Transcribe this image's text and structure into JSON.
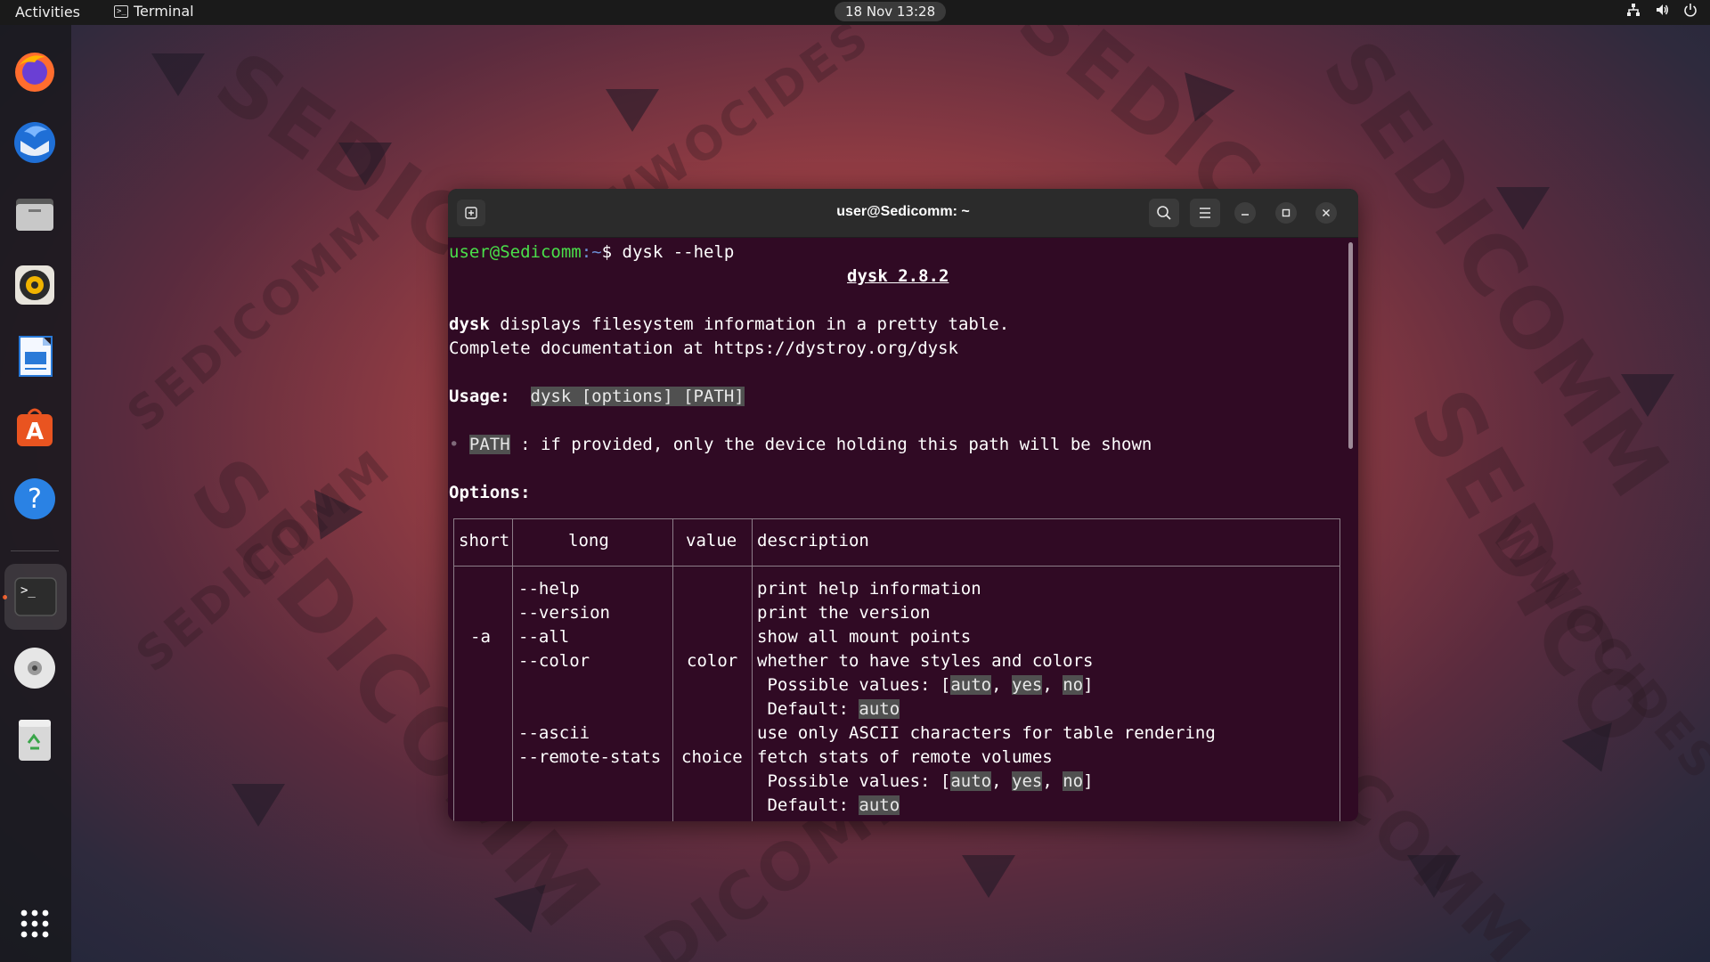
{
  "topbar": {
    "activities": "Activities",
    "app_name": "Terminal",
    "clock": "18 Nov  13:28"
  },
  "dock": {
    "items": [
      {
        "name": "Firefox",
        "icon": "firefox-icon"
      },
      {
        "name": "Thunderbird",
        "icon": "thunderbird-icon"
      },
      {
        "name": "Files",
        "icon": "files-icon"
      },
      {
        "name": "Rhythmbox",
        "icon": "rhythmbox-icon"
      },
      {
        "name": "LibreOffice Writer",
        "icon": "writer-icon"
      },
      {
        "name": "Ubuntu Software",
        "icon": "software-icon"
      },
      {
        "name": "Help",
        "icon": "help-icon"
      },
      {
        "name": "Terminal",
        "icon": "terminal-icon"
      },
      {
        "name": "DVD",
        "icon": "disc-icon"
      },
      {
        "name": "Trash",
        "icon": "trash-icon"
      },
      {
        "name": "Show Applications",
        "icon": "app-grid-icon"
      }
    ]
  },
  "window": {
    "title": "user@Sedicomm: ~"
  },
  "terminal": {
    "prompt_user": "user@Sedicomm",
    "prompt_path": ":~",
    "prompt_symbol": "$ ",
    "command": "dysk --help",
    "heading": "dysk 2.8.2",
    "desc_bold": "dysk",
    "desc_rest": " displays filesystem information in a pretty table.",
    "doc_line": "Complete documentation at https://dystroy.org/dysk",
    "usage_label": "Usage:",
    "usage_value": "dysk [options] [PATH]",
    "bullet": "•",
    "path_arg": "PATH",
    "path_desc": " : if provided, only the device holding this path will be shown",
    "options_label": "Options:",
    "table": {
      "headers": {
        "short": "short",
        "long": "long",
        "value": "value",
        "description": "description"
      },
      "short_a": "-a",
      "long": [
        "--help",
        "--version",
        "--all",
        "--color",
        "",
        "",
        "--ascii",
        "--remote-stats",
        "",
        ""
      ],
      "value_color": "color",
      "value_choice": "choice",
      "desc": {
        "help": "print help information",
        "version": "print the version",
        "all": "show all mount points",
        "color": "whether to have styles and colors",
        "ascii": "use only ASCII characters for table rendering",
        "remote": "fetch stats of remote volumes",
        "possible_prefix": " Possible values: [",
        "v_auto": "auto",
        "v_yes": "yes",
        "v_no": "no",
        "comma": ", ",
        "close": "]",
        "default_prefix": " Default: "
      }
    }
  },
  "colors": {
    "terminal_bg": "#300a24",
    "prompt_user": "#4ae04a",
    "prompt_path": "#6c8fd4",
    "highlight_bg": "#505050",
    "accent": "#e95420"
  }
}
